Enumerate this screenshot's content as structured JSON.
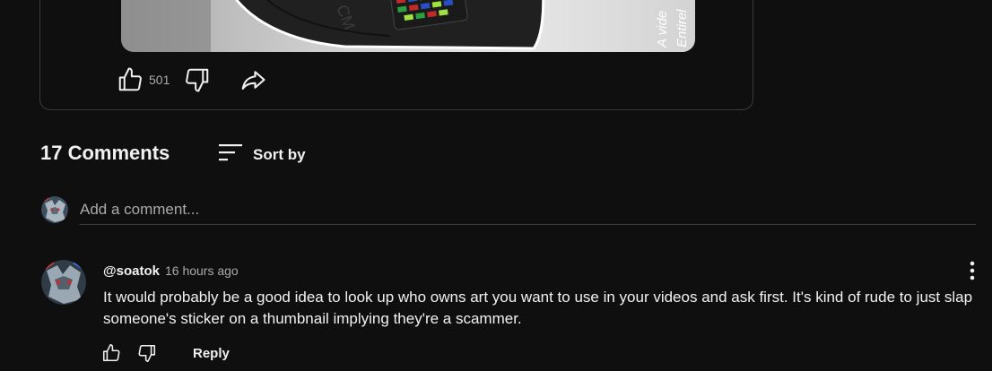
{
  "thumbnail": {
    "caption_lines": [
      "A vide",
      "Entirel"
    ],
    "brand_text": "CM"
  },
  "post": {
    "like_count": "501",
    "icons": {
      "like": "thumbs-up-icon",
      "dislike": "thumbs-down-icon",
      "share": "share-icon"
    }
  },
  "comments_section": {
    "count_label": "17 Comments",
    "sort_label": "Sort by",
    "add_comment_placeholder": "Add a comment..."
  },
  "comments": [
    {
      "author": "@soatok",
      "time": "16 hours ago",
      "text": "It would probably be a good idea to look up who owns art you want to use in your videos and ask first. It's kind of rude to just slap someone's sticker on a thumbnail implying they're a scammer.",
      "reply_label": "Reply"
    }
  ],
  "colors": {
    "background": "#0f0f0f",
    "text_primary": "#f1f1f1",
    "text_secondary": "#aaaaaa",
    "border": "#3a3a3a"
  }
}
